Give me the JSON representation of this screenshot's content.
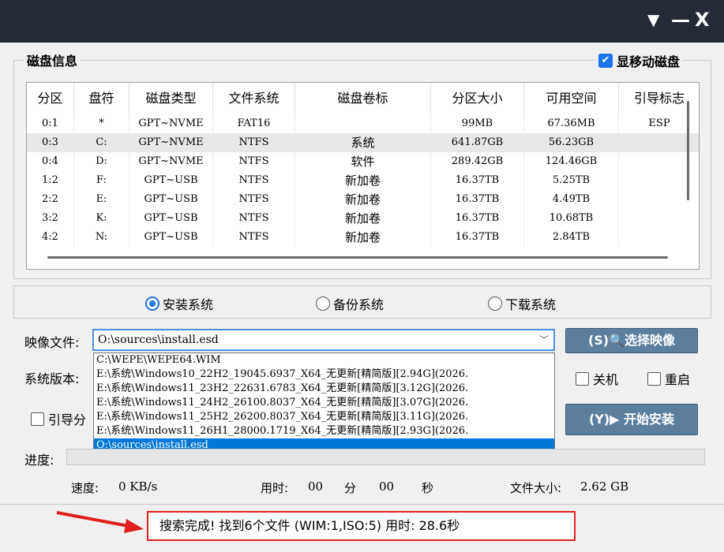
{
  "titlebar": {
    "dropdown_glyph": "▼",
    "minimize_glyph": "—",
    "close_glyph": "X"
  },
  "disk_group": {
    "title": "磁盘信息",
    "show_removable_label": "显移动磁盘",
    "show_removable_checked": true
  },
  "table": {
    "columns": [
      "分区",
      "盘符",
      "磁盘类型",
      "文件系统",
      "磁盘卷标",
      "分区大小",
      "可用空间",
      "引导标志"
    ],
    "rows": [
      [
        "0:1",
        "*",
        "GPT~NVME",
        "FAT16",
        "",
        "99MB",
        "67.36MB",
        "ESP"
      ],
      [
        "0:3",
        "C:",
        "GPT~NVME",
        "NTFS",
        "系统",
        "641.87GB",
        "56.23GB",
        ""
      ],
      [
        "0:4",
        "D:",
        "GPT~NVME",
        "NTFS",
        "软件",
        "289.42GB",
        "124.46GB",
        ""
      ],
      [
        "1:2",
        "F:",
        "GPT~USB",
        "NTFS",
        "新加卷",
        "16.37TB",
        "5.25TB",
        ""
      ],
      [
        "2:2",
        "E:",
        "GPT~USB",
        "NTFS",
        "新加卷",
        "16.37TB",
        "4.49TB",
        ""
      ],
      [
        "3:2",
        "K:",
        "GPT~USB",
        "NTFS",
        "新加卷",
        "16.37TB",
        "10.68TB",
        ""
      ],
      [
        "4:2",
        "N:",
        "GPT~USB",
        "NTFS",
        "新加卷",
        "16.37TB",
        "2.84TB",
        ""
      ]
    ],
    "selected_row": 1
  },
  "modes": {
    "install": "安装系统",
    "backup": "备份系统",
    "download": "下载系统",
    "selected": "install"
  },
  "image": {
    "label": "映像文件:",
    "value": "O:\\sources\\install.esd",
    "select_button": "(S)🔍选择映像",
    "options": [
      "C:\\WEPE\\WEPE64.WIM",
      "E:\\系统\\Windows10_22H2_19045.6937_X64_无更新[精简版][2.94G](2026.",
      "E:\\系统\\Windows11_23H2_22631.6783_X64_无更新[精简版][3.12G](2026.",
      "E:\\系统\\Windows11_24H2_26100.8037_X64_无更新[精简版][3.07G](2026.",
      "E:\\系统\\Windows11_25H2_26200.8037_X64_无更新[精简版][3.11G](2026.",
      "E:\\系统\\Windows11_26H1_28000.1719_X64_无更新[精简版][2.93G](2026.",
      "O:\\sources\\install.esd"
    ],
    "selected_option": 6
  },
  "version_label": "系统版本:",
  "boot_partition_label": "引导分",
  "shutdown_label": "关机",
  "restart_label": "重启",
  "install_button": "(Y)▶ 开始安装",
  "progress": {
    "label": "进度:",
    "fraction": 0
  },
  "stats": {
    "speed_label": "速度:",
    "speed_value": "0 KB/s",
    "time_label": "用时:",
    "minutes": "00",
    "minute_unit": "分",
    "seconds": "00",
    "second_unit": "秒",
    "size_label": "文件大小:",
    "size_value": "2.62 GB"
  },
  "status": {
    "text": "搜索完成! 找到6个文件 (WIM:1,ISO:5) 用时: 28.6秒"
  },
  "colors": {
    "titlebar": "#252a37",
    "accent": "#1a73e8",
    "button": "#5d7f9f",
    "highlight_border": "#e02020",
    "arrow": "#e02020"
  }
}
